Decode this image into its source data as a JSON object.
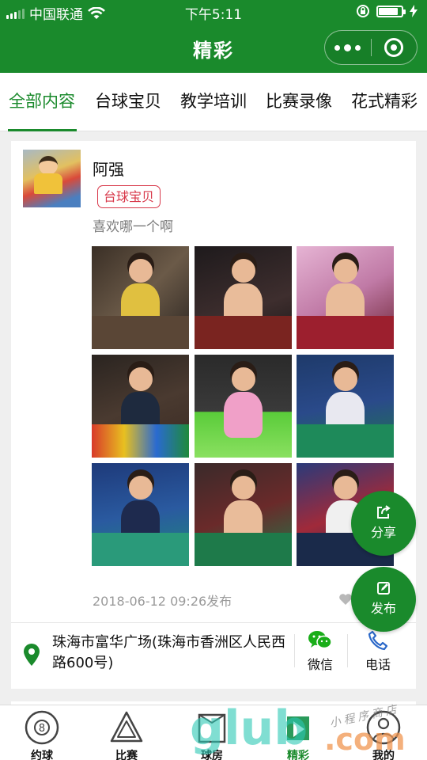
{
  "status_bar": {
    "carrier": "中国联通",
    "time": "下午5:11",
    "battery_level": 0.85
  },
  "nav": {
    "title": "精彩"
  },
  "tabs": [
    "全部内容",
    "台球宝贝",
    "教学培训",
    "比赛录像",
    "花式精彩"
  ],
  "active_tab": "全部内容",
  "post": {
    "username": "阿强",
    "tag": "台球宝贝",
    "text": "喜欢哪一个啊",
    "time": "2018-06-12 09:26发布",
    "photo_count": 9,
    "address": "珠海市富华广场(珠海市香洲区人民西路600号)",
    "wechat_label": "微信",
    "phone_label": "电话"
  },
  "fabs": {
    "share_label": "分享",
    "publish_label": "发布"
  },
  "tabbar": {
    "items": [
      "约球",
      "比赛",
      "球房",
      "精彩",
      "我的"
    ]
  },
  "watermark": {
    "text": "glub",
    "domain": ".com",
    "caption": "小程序商店"
  },
  "colors": {
    "brand_green": "#1a8a2c",
    "tag_red": "#d8384a",
    "wechat_green": "#1aad19",
    "phone_blue": "#2a67c8"
  }
}
